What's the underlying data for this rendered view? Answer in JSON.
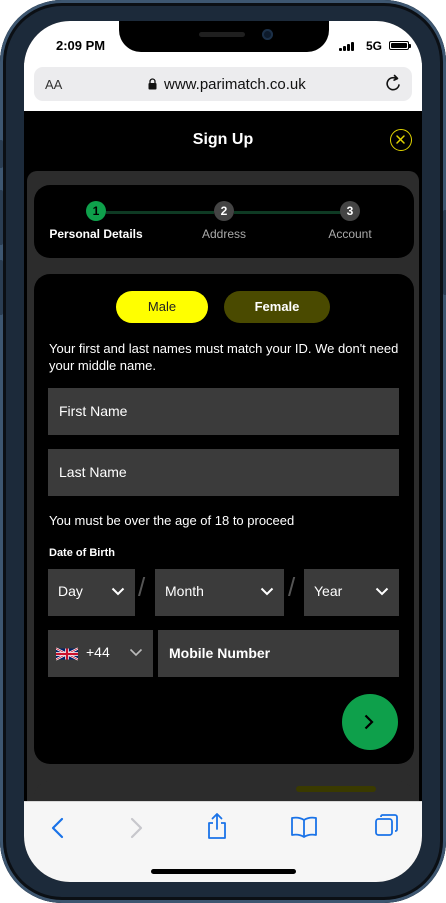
{
  "status_bar": {
    "time": "2:09 PM",
    "network": "5G"
  },
  "browser": {
    "text_size": "AA",
    "url": "www.parimatch.co.uk"
  },
  "page": {
    "title": "Sign Up"
  },
  "stepper": {
    "steps": [
      {
        "number": "1",
        "label": "Personal Details",
        "active": true
      },
      {
        "number": "2",
        "label": "Address",
        "active": false
      },
      {
        "number": "3",
        "label": "Account",
        "active": false
      }
    ]
  },
  "gender": {
    "male": "Male",
    "female": "Female",
    "selected": "Male"
  },
  "form": {
    "name_note": "Your first and last names must match your ID. We don't need your middle name.",
    "first_name_placeholder": "First Name",
    "last_name_placeholder": "Last Name",
    "age_note": "You must be over the age of 18 to proceed",
    "dob_label": "Date of Birth",
    "day": "Day",
    "month": "Month",
    "year": "Year",
    "separator": "/",
    "phone_code": "+44",
    "mobile_placeholder": "Mobile Number"
  },
  "icons": {
    "close": "close-icon",
    "next": "chevron-right-icon",
    "back": "back-icon",
    "forward": "forward-icon",
    "share": "share-icon",
    "bookmarks": "bookmarks-icon",
    "tabs": "tabs-icon",
    "flag": "uk-flag-icon"
  },
  "colors": {
    "accent_yellow": "#ffff00",
    "brand_green": "#0ea04b",
    "background": "#000000"
  }
}
